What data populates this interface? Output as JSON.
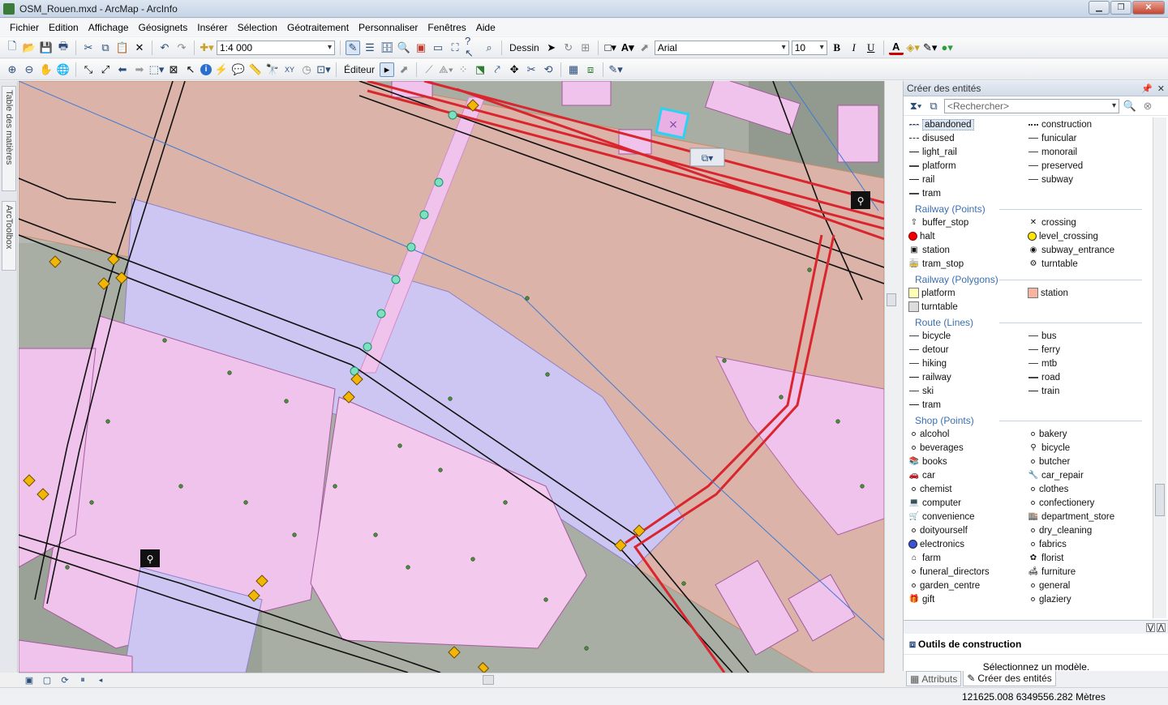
{
  "window": {
    "title": "OSM_Rouen.mxd - ArcMap - ArcInfo"
  },
  "menu": [
    "Fichier",
    "Edition",
    "Affichage",
    "Géosignets",
    "Insérer",
    "Sélection",
    "Géotraitement",
    "Personnaliser",
    "Fenêtres",
    "Aide"
  ],
  "toolbar": {
    "scale": "1:4 000",
    "draw_label": "Dessin",
    "font_name": "Arial",
    "font_size": "10",
    "bold": "B",
    "italic": "I",
    "underline": "U",
    "font_color_letter": "A",
    "editor_label": "Éditeur"
  },
  "left_tabs": {
    "toc": "Table des matières",
    "toolbox": "ArcToolbox"
  },
  "panel": {
    "title": "Créer des entités",
    "search_placeholder": "<Rechercher>",
    "railway_lines": [
      {
        "label": "abandoned",
        "icon": "dashed-line-icon",
        "selected": true
      },
      {
        "label": "construction",
        "icon": "hatched-line-icon"
      },
      {
        "label": "disused",
        "icon": "dashed-line-icon"
      },
      {
        "label": "funicular",
        "icon": "line-icon"
      },
      {
        "label": "light_rail",
        "icon": "rail-line-icon"
      },
      {
        "label": "monorail",
        "icon": "line-icon"
      },
      {
        "label": "platform",
        "icon": "thick-line-icon"
      },
      {
        "label": "preserved",
        "icon": "line-icon"
      },
      {
        "label": "rail",
        "icon": "rail-line-icon"
      },
      {
        "label": "subway",
        "icon": "line-icon"
      },
      {
        "label": "tram",
        "icon": "thick-line-icon"
      }
    ],
    "railway_points_title": "Railway (Points)",
    "railway_points": [
      {
        "label": "buffer_stop",
        "icon": "buffer-stop-icon"
      },
      {
        "label": "crossing",
        "icon": "crossing-icon"
      },
      {
        "label": "halt",
        "icon": "red-dot-icon"
      },
      {
        "label": "level_crossing",
        "icon": "yellow-dot-icon"
      },
      {
        "label": "station",
        "icon": "station-icon"
      },
      {
        "label": "subway_entrance",
        "icon": "subway-entrance-icon"
      },
      {
        "label": "tram_stop",
        "icon": "tram-icon"
      },
      {
        "label": "turntable",
        "icon": "turntable-icon"
      }
    ],
    "railway_polygons_title": "Railway (Polygons)",
    "railway_polygons": [
      {
        "label": "platform",
        "icon": "yellow-box-icon"
      },
      {
        "label": "station",
        "icon": "salmon-box-icon"
      },
      {
        "label": "turntable",
        "icon": "gray-box-icon"
      }
    ],
    "route_lines_title": "Route (Lines)",
    "route_lines": [
      {
        "label": "bicycle",
        "icon": "line-icon"
      },
      {
        "label": "bus",
        "icon": "line-icon"
      },
      {
        "label": "detour",
        "icon": "line-icon"
      },
      {
        "label": "ferry",
        "icon": "line-icon"
      },
      {
        "label": "hiking",
        "icon": "line-icon"
      },
      {
        "label": "mtb",
        "icon": "line-icon"
      },
      {
        "label": "railway",
        "icon": "rail-line-icon"
      },
      {
        "label": "road",
        "icon": "thick-line-icon"
      },
      {
        "label": "ski",
        "icon": "line-icon"
      },
      {
        "label": "train",
        "icon": "rail-line-icon"
      },
      {
        "label": "tram",
        "icon": "rail-line-icon"
      }
    ],
    "shop_points_title": "Shop (Points)",
    "shop_points": [
      {
        "label": "alcohol",
        "icon": "dot-icon"
      },
      {
        "label": "bakery",
        "icon": "dot-icon"
      },
      {
        "label": "beverages",
        "icon": "dot-icon"
      },
      {
        "label": "bicycle",
        "icon": "bicycle-icon"
      },
      {
        "label": "books",
        "icon": "books-icon"
      },
      {
        "label": "butcher",
        "icon": "dot-icon"
      },
      {
        "label": "car",
        "icon": "car-icon"
      },
      {
        "label": "car_repair",
        "icon": "car-repair-icon"
      },
      {
        "label": "chemist",
        "icon": "dot-icon"
      },
      {
        "label": "clothes",
        "icon": "dot-icon"
      },
      {
        "label": "computer",
        "icon": "computer-icon"
      },
      {
        "label": "confectionery",
        "icon": "dot-icon"
      },
      {
        "label": "convenience",
        "icon": "convenience-icon"
      },
      {
        "label": "department_store",
        "icon": "department-store-icon"
      },
      {
        "label": "doityourself",
        "icon": "dot-icon"
      },
      {
        "label": "dry_cleaning",
        "icon": "dot-icon"
      },
      {
        "label": "electronics",
        "icon": "blue-dot-icon"
      },
      {
        "label": "fabrics",
        "icon": "dot-icon"
      },
      {
        "label": "farm",
        "icon": "farm-icon"
      },
      {
        "label": "florist",
        "icon": "florist-icon"
      },
      {
        "label": "funeral_directors",
        "icon": "dot-icon"
      },
      {
        "label": "furniture",
        "icon": "furniture-icon"
      },
      {
        "label": "garden_centre",
        "icon": "dot-icon"
      },
      {
        "label": "general",
        "icon": "dot-icon"
      },
      {
        "label": "gift",
        "icon": "gift-icon"
      },
      {
        "label": "glaziery",
        "icon": "dot-icon"
      }
    ]
  },
  "construction": {
    "title": "Outils de construction",
    "message": "Sélectionnez un modèle."
  },
  "bottom_tabs": [
    "Attributs",
    "Créer des entités"
  ],
  "status": {
    "coordinates": "121625.008  6349556.282 Mètres"
  },
  "colors": {
    "railway_red": "#d9262e",
    "landuse_salmon": "#dcb3a8",
    "landuse_lavender": "#cdc6f2",
    "building_pink": "#f2c4ec",
    "selection_cyan": "#2ad3f2",
    "accent_blue": "#3a6fb0"
  }
}
